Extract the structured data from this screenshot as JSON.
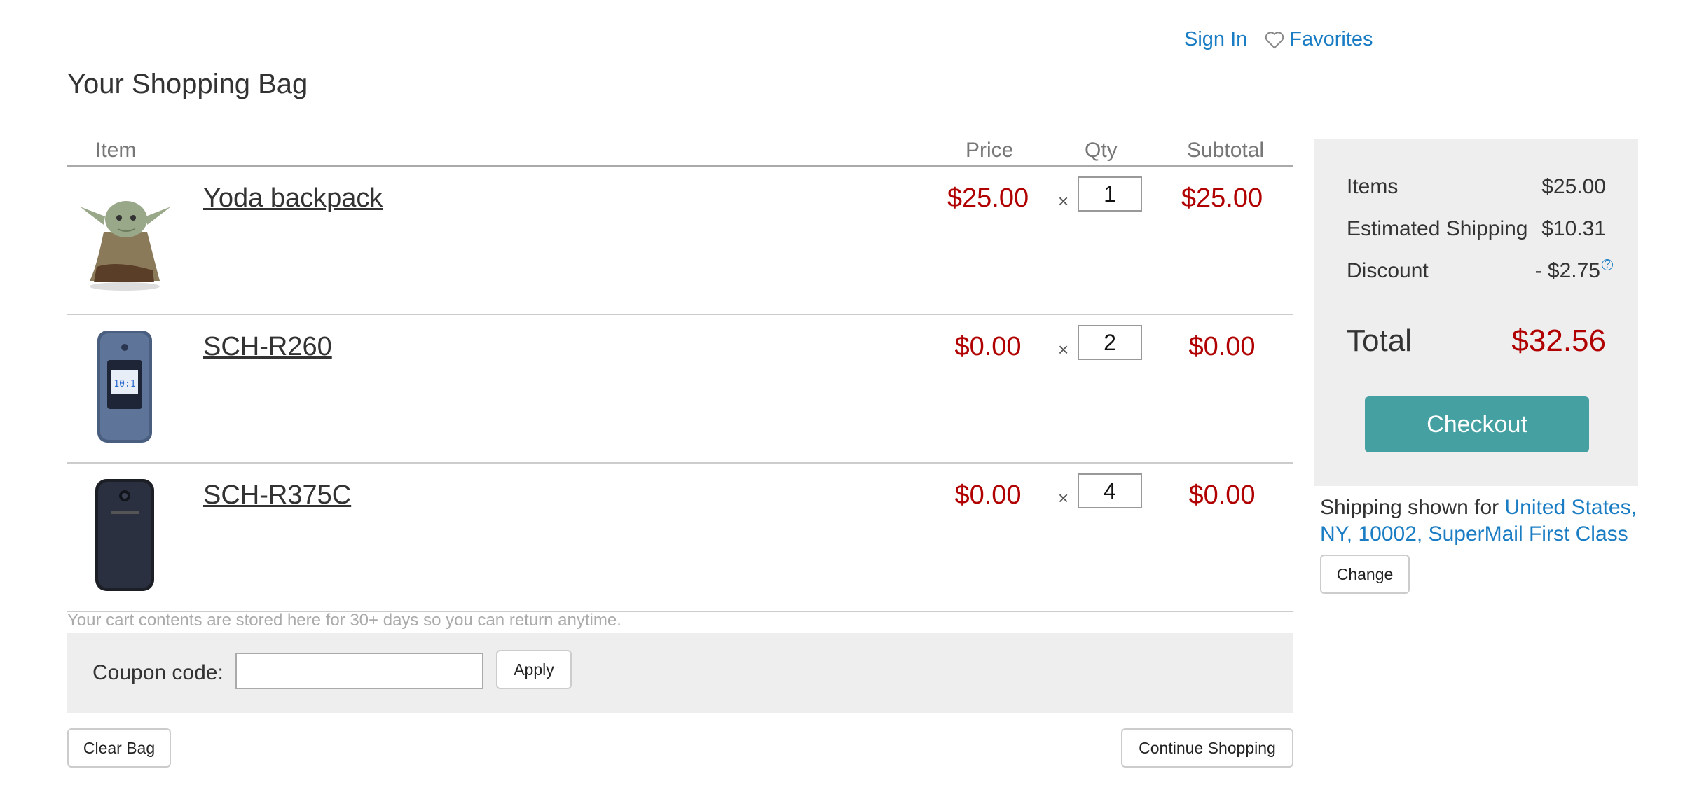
{
  "header": {
    "sign_in": "Sign In",
    "favorites": "Favorites"
  },
  "page_title": "Your Shopping Bag",
  "table": {
    "columns": {
      "item": "Item",
      "price": "Price",
      "qty": "Qty",
      "subtotal": "Subtotal"
    },
    "times_symbol": "×",
    "rows": [
      {
        "name": "Yoda backpack",
        "price": "$25.00",
        "qty": "1",
        "subtotal": "$25.00",
        "image_icon": "yoda-backpack-image"
      },
      {
        "name": "SCH-R260",
        "price": "$0.00",
        "qty": "2",
        "subtotal": "$0.00",
        "image_icon": "flip-phone-image"
      },
      {
        "name": "SCH-R375C",
        "price": "$0.00",
        "qty": "4",
        "subtotal": "$0.00",
        "image_icon": "flip-phone-image"
      }
    ]
  },
  "storage_note": "Your cart contents are stored here for 30+ days so you can return anytime.",
  "coupon": {
    "label": "Coupon code:",
    "value": "",
    "apply_label": "Apply"
  },
  "actions": {
    "clear_bag": "Clear Bag",
    "continue_shopping": "Continue Shopping"
  },
  "summary": {
    "items_label": "Items",
    "items_value": "$25.00",
    "shipping_label": "Estimated Shipping",
    "shipping_value": "$10.31",
    "discount_label": "Discount",
    "discount_value": "- $2.75",
    "help_icon": "?",
    "total_label": "Total",
    "total_value": "$32.56",
    "checkout_label": "Checkout"
  },
  "shipping_info": {
    "prefix": "Shipping shown for ",
    "destination": "United States, NY, 10002, SuperMail First Class",
    "change_label": "Change"
  },
  "colors": {
    "price_red": "#b00000",
    "link_blue": "#1a7dc4",
    "checkout_teal": "#45a0a2",
    "panel_gray": "#eeeeee"
  }
}
